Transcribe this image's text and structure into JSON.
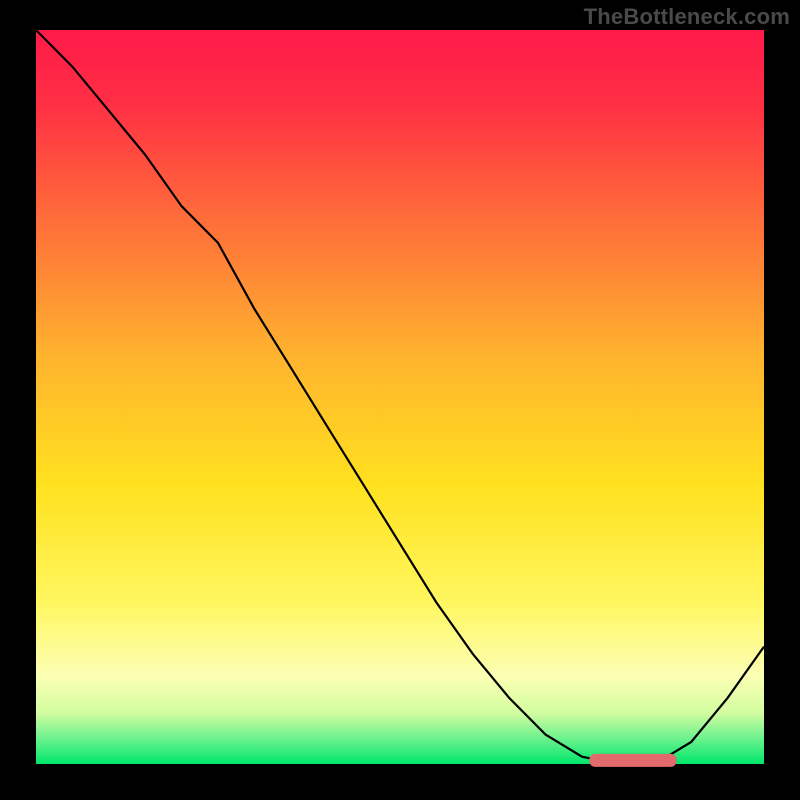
{
  "watermark": "TheBottleneck.com",
  "colors": {
    "frame_border": "#000000",
    "curve": "#000000",
    "marker_fill": "#e16a6d",
    "gradient_stops": [
      {
        "offset": 0.0,
        "color": "#ff1a4a"
      },
      {
        "offset": 0.1,
        "color": "#ff2f44"
      },
      {
        "offset": 0.25,
        "color": "#ff6a3a"
      },
      {
        "offset": 0.45,
        "color": "#ffb52e"
      },
      {
        "offset": 0.62,
        "color": "#ffe11e"
      },
      {
        "offset": 0.78,
        "color": "#fff760"
      },
      {
        "offset": 0.88,
        "color": "#fcffb4"
      },
      {
        "offset": 0.93,
        "color": "#d3fda0"
      },
      {
        "offset": 0.965,
        "color": "#6df28e"
      },
      {
        "offset": 1.0,
        "color": "#00e66b"
      }
    ]
  },
  "chart_data": {
    "type": "line",
    "title": "",
    "xlabel": "",
    "ylabel": "",
    "xlim": [
      0,
      100
    ],
    "ylim": [
      0,
      100
    ],
    "x": [
      0,
      5,
      10,
      15,
      20,
      25,
      30,
      35,
      40,
      45,
      50,
      55,
      60,
      65,
      70,
      75,
      80,
      85,
      90,
      95,
      100
    ],
    "values": [
      100,
      95,
      89,
      83,
      76,
      71,
      62,
      54,
      46,
      38,
      30,
      22,
      15,
      9,
      4,
      1,
      0,
      0,
      3,
      9,
      16
    ],
    "marker_segment": {
      "x_start": 76,
      "x_end": 88,
      "y": 0.5
    },
    "notes": "Values are the curve height as a percentage of the plot area (0 = bottom/green, 100 = top/red). The curve descends from top-left, inflects slightly near x≈25, reaches a flat minimum around x≈78–88 (highlighted by the marker), then rises toward the right edge."
  }
}
